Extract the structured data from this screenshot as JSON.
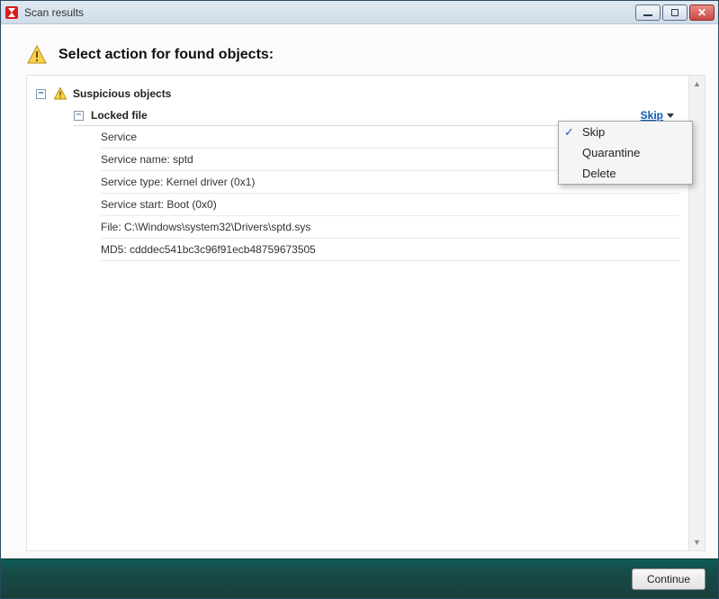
{
  "window": {
    "title": "Scan results"
  },
  "header": {
    "heading": "Select action for found objects:"
  },
  "group": {
    "label": "Suspicious objects",
    "item": {
      "label": "Locked file",
      "selected_action": "Skip",
      "details": [
        "Service",
        "Service name: sptd",
        "Service type: Kernel driver (0x1)",
        "Service start: Boot (0x0)",
        "File: C:\\Windows\\system32\\Drivers\\sptd.sys",
        "MD5: cdddec541bc3c96f91ecb48759673505"
      ]
    }
  },
  "menu": {
    "items": [
      "Skip",
      "Quarantine",
      "Delete"
    ],
    "selected": "Skip"
  },
  "footer": {
    "continue_label": "Continue"
  }
}
